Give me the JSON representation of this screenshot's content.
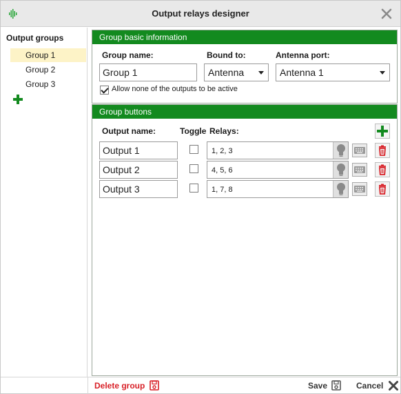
{
  "window": {
    "title": "Output relays designer"
  },
  "sidebar": {
    "title": "Output groups",
    "groups": [
      {
        "label": "Group 1",
        "selected": true
      },
      {
        "label": "Group 2",
        "selected": false
      },
      {
        "label": "Group 3",
        "selected": false
      }
    ]
  },
  "basic_info": {
    "header": "Group basic information",
    "group_name_label": "Group name:",
    "group_name_value": "Group 1",
    "bound_to_label": "Bound to:",
    "bound_to_value": "Antenna",
    "antenna_port_label": "Antenna port:",
    "antenna_port_value": "Antenna 1",
    "allow_none_label": "Allow none of the outputs to be active",
    "allow_none_checked": true
  },
  "group_buttons": {
    "header": "Group buttons",
    "col_output_name": "Output name:",
    "col_toggle": "Toggle",
    "col_relays": "Relays:",
    "rows": [
      {
        "name": "Output 1",
        "toggle": false,
        "relays": "1, 2, 3"
      },
      {
        "name": "Output 2",
        "toggle": false,
        "relays": "4, 5, 6"
      },
      {
        "name": "Output 3",
        "toggle": false,
        "relays": "1, 7, 8"
      }
    ]
  },
  "footer": {
    "delete_group": "Delete group",
    "save": "Save",
    "cancel": "Cancel"
  },
  "colors": {
    "accent_green": "#138a1f",
    "selection_yellow": "#fdf3c7",
    "danger_red": "#d81f26"
  },
  "icons": [
    "app-waveform-icon",
    "close-icon",
    "plus-icon",
    "lightbulb-icon",
    "keyboard-icon",
    "trash-icon",
    "save-icon",
    "cancel-x-icon"
  ]
}
